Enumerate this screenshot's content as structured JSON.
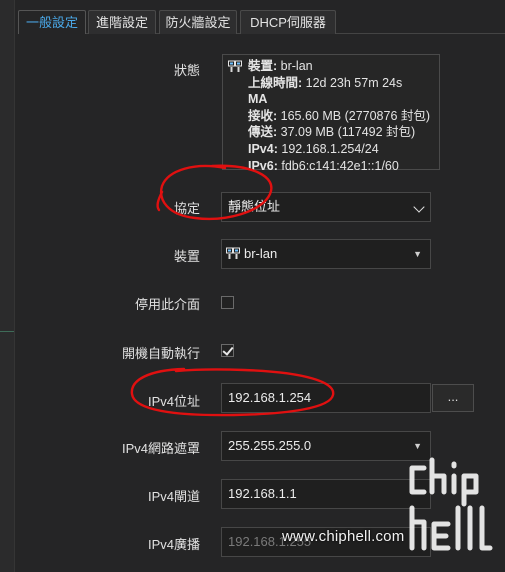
{
  "tabs": [
    "一般設定",
    "進階設定",
    "防火牆設定",
    "DHCP伺服器"
  ],
  "status": {
    "label": "狀態",
    "icon": "network-interface-icon",
    "lines": [
      {
        "k": "裝置:",
        "v": " br-lan"
      },
      {
        "k": "上線時間:",
        "v": " 12d 23h 57m 24s"
      },
      {
        "k": "MA",
        "v": ""
      },
      {
        "k": "接收:",
        "v": " 165.60 MB (2770876 封包)"
      },
      {
        "k": "傳送:",
        "v": " 37.09 MB (117492 封包)"
      },
      {
        "k": "IPv4:",
        "v": " 192.168.1.254/24"
      },
      {
        "k": "IPv6:",
        "v": " fdb6:c141:42e1::1/60"
      }
    ]
  },
  "protocol": {
    "label": "協定",
    "value": "靜態位址"
  },
  "device": {
    "label": "裝置",
    "value": "br-lan"
  },
  "disable_iface": {
    "label": "停用此介面",
    "checked": false
  },
  "autostart": {
    "label": "開機自動執行",
    "checked": true
  },
  "ipv4_addr": {
    "label": "IPv4位址",
    "value": "192.168.1.254",
    "more": "..."
  },
  "ipv4_mask": {
    "label": "IPv4網路遮罩",
    "value": "255.255.255.0"
  },
  "ipv4_gw": {
    "label": "IPv4閘道",
    "value": "192.168.1.1"
  },
  "ipv4_bcast": {
    "label": "IPv4廣播",
    "placeholder": "192.168.1.255"
  },
  "watermark": {
    "url": "www.chiphell.com"
  },
  "colors": {
    "accent": "#4aa8e8",
    "annotation": "#e01010"
  }
}
